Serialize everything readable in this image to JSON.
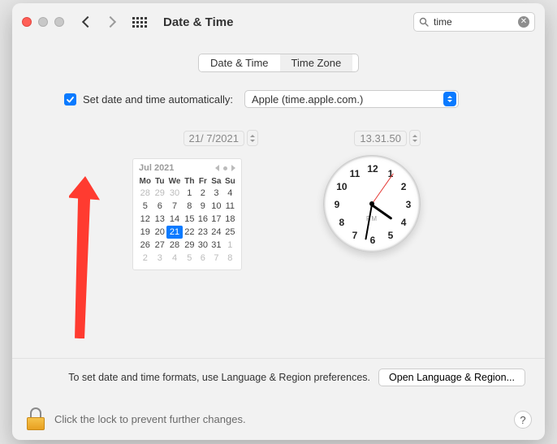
{
  "header": {
    "title": "Date & Time",
    "search_value": "time"
  },
  "tabs": {
    "date_time": "Date & Time",
    "time_zone": "Time Zone"
  },
  "auto": {
    "label": "Set date and time automatically:",
    "server": "Apple (time.apple.com.)",
    "checked": true
  },
  "date_field": "21/  7/2021",
  "time_field": "13.31.50",
  "calendar": {
    "title": "Jul 2021",
    "dows": [
      "Mo",
      "Tu",
      "We",
      "Th",
      "Fr",
      "Sa",
      "Su"
    ],
    "weeks": [
      [
        {
          "d": "28",
          "o": true
        },
        {
          "d": "29",
          "o": true
        },
        {
          "d": "30",
          "o": true
        },
        {
          "d": "1"
        },
        {
          "d": "2"
        },
        {
          "d": "3"
        },
        {
          "d": "4"
        }
      ],
      [
        {
          "d": "5"
        },
        {
          "d": "6"
        },
        {
          "d": "7"
        },
        {
          "d": "8"
        },
        {
          "d": "9"
        },
        {
          "d": "10"
        },
        {
          "d": "11"
        }
      ],
      [
        {
          "d": "12"
        },
        {
          "d": "13"
        },
        {
          "d": "14"
        },
        {
          "d": "15"
        },
        {
          "d": "16"
        },
        {
          "d": "17"
        },
        {
          "d": "18"
        }
      ],
      [
        {
          "d": "19"
        },
        {
          "d": "20"
        },
        {
          "d": "21",
          "t": true
        },
        {
          "d": "22"
        },
        {
          "d": "23"
        },
        {
          "d": "24"
        },
        {
          "d": "25"
        }
      ],
      [
        {
          "d": "26"
        },
        {
          "d": "27"
        },
        {
          "d": "28"
        },
        {
          "d": "29"
        },
        {
          "d": "30"
        },
        {
          "d": "31"
        },
        {
          "d": "1",
          "o": true
        }
      ],
      [
        {
          "d": "2",
          "o": true
        },
        {
          "d": "3",
          "o": true
        },
        {
          "d": "4",
          "o": true
        },
        {
          "d": "5",
          "o": true
        },
        {
          "d": "6",
          "o": true
        },
        {
          "d": "7",
          "o": true
        },
        {
          "d": "8",
          "o": true
        }
      ]
    ]
  },
  "clock": {
    "brand": "PM",
    "numbers": [
      "12",
      "1",
      "2",
      "3",
      "4",
      "5",
      "6",
      "7",
      "8",
      "9",
      "10",
      "11"
    ]
  },
  "footer": {
    "text": "To set date and time formats, use Language & Region preferences.",
    "button": "Open Language & Region..."
  },
  "lock": {
    "text": "Click the lock to prevent further changes."
  },
  "help": "?"
}
